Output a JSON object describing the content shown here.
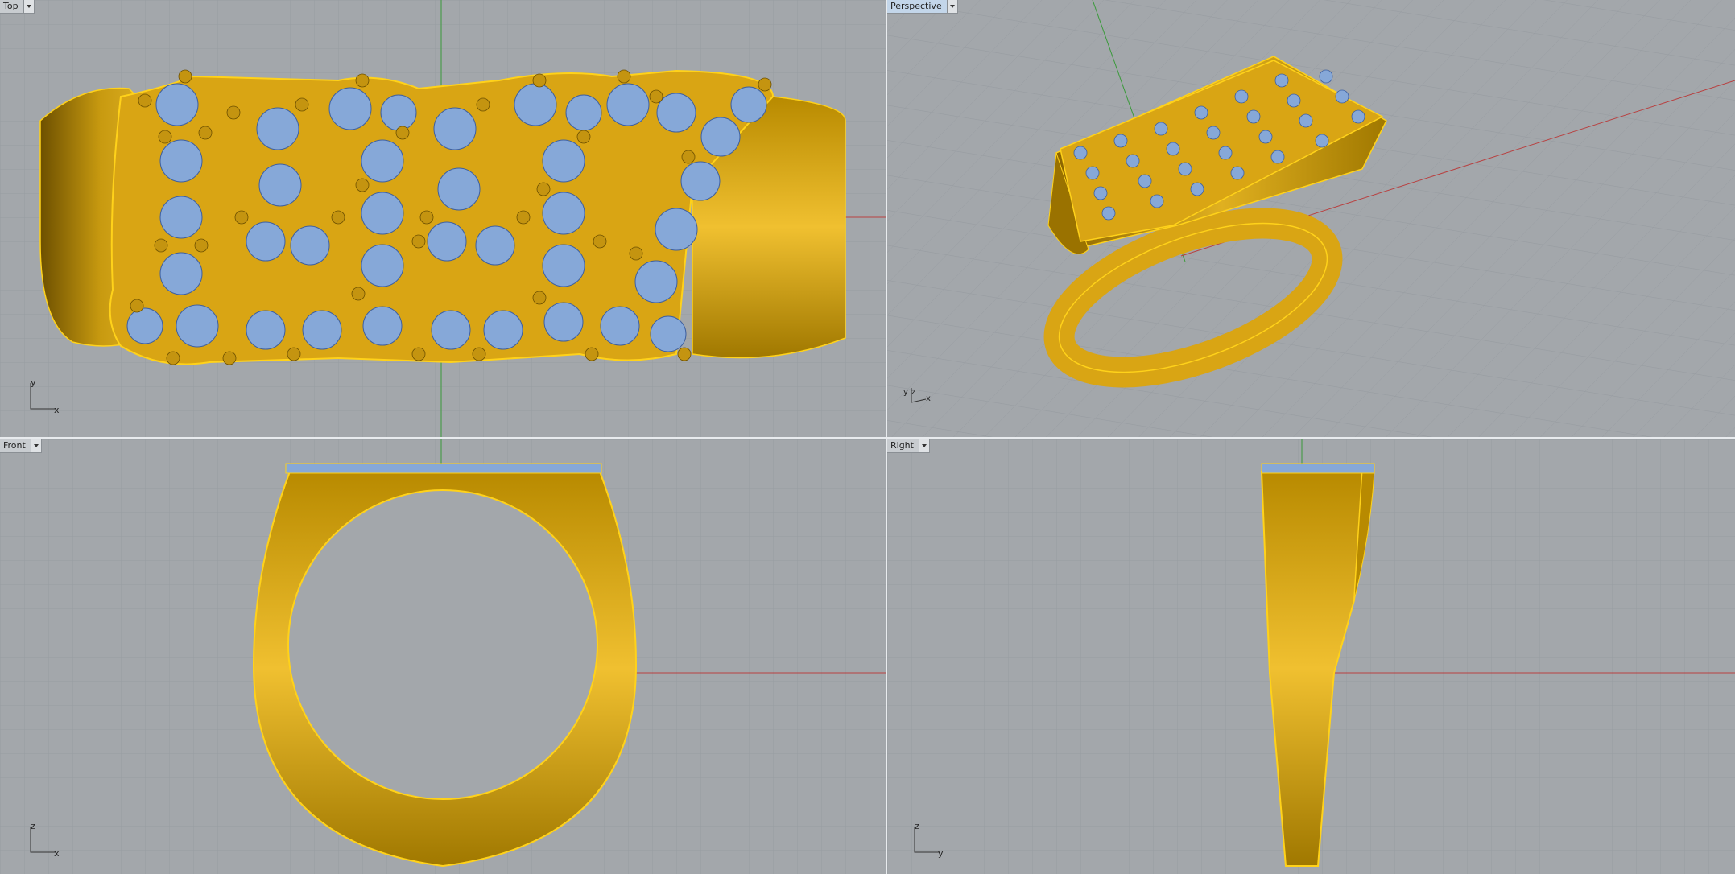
{
  "viewports": {
    "top": {
      "label": "Top",
      "axes": [
        "y",
        "x"
      ]
    },
    "perspective": {
      "label": "Perspective",
      "axes": [
        "y",
        "z",
        "x"
      ]
    },
    "front": {
      "label": "Front",
      "axes": [
        "z",
        "x"
      ]
    },
    "right": {
      "label": "Right",
      "axes": [
        "z",
        "y"
      ]
    }
  },
  "colors": {
    "background": "#a3a7ab",
    "grid_minor": "#979ca1",
    "grid_major": "#8a8f94",
    "axis_x": "#b84040",
    "axis_y": "#3a9a3a",
    "gold": "#d9a514",
    "gold_dark": "#8a6400",
    "gold_edge": "#ffd21a",
    "gem": "#86a8d8",
    "active_label": "#c3d6ea"
  },
  "icons": {
    "viewport_menu": "chevron-down-icon"
  }
}
